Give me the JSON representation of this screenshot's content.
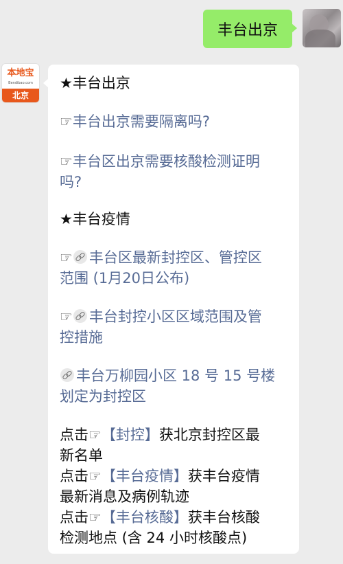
{
  "user_message": {
    "text": "丰台出京"
  },
  "bot": {
    "logo_name": "本地宝",
    "logo_url": "Bendibao.com",
    "logo_city": "北京"
  },
  "reply": {
    "section1_title": "★丰台出京",
    "link1": "丰台出京需要隔离吗?",
    "link2_line1": "丰台区出京需要核酸检测证明",
    "link2_line2": "吗?",
    "section2_title": "★丰台疫情",
    "link3_line1": "丰台区最新封控区、管控区",
    "link3_line2": "范围 (1月20日公布)",
    "link4_line1": "丰台封控小区区域范围及管",
    "link4_line2": "控措施",
    "link5_line1": "丰台万柳园小区 18 号 15 号楼",
    "link5_line2": "划定为封控区",
    "cta1_prefix": "点击",
    "cta1_keyword": "【封控】",
    "cta1_suffix": "获北京封控区最",
    "cta1_line2": "新名单",
    "cta2_prefix": "点击",
    "cta2_keyword": "【丰台疫情】",
    "cta2_suffix": "获丰台疫情",
    "cta2_line2": "最新消息及病例轨迹",
    "cta3_prefix": "点击",
    "cta3_keyword": "【丰台核酸】",
    "cta3_suffix": "获丰台核酸",
    "cta3_line2": "检测地点 (含 24 小时核酸点)"
  },
  "icons": {
    "pointing_hand": "☞",
    "link_chain": "link-icon"
  },
  "colors": {
    "user_bubble": "#95ec69",
    "link": "#576b95",
    "background": "#ececec",
    "brand": "#e8581c"
  }
}
